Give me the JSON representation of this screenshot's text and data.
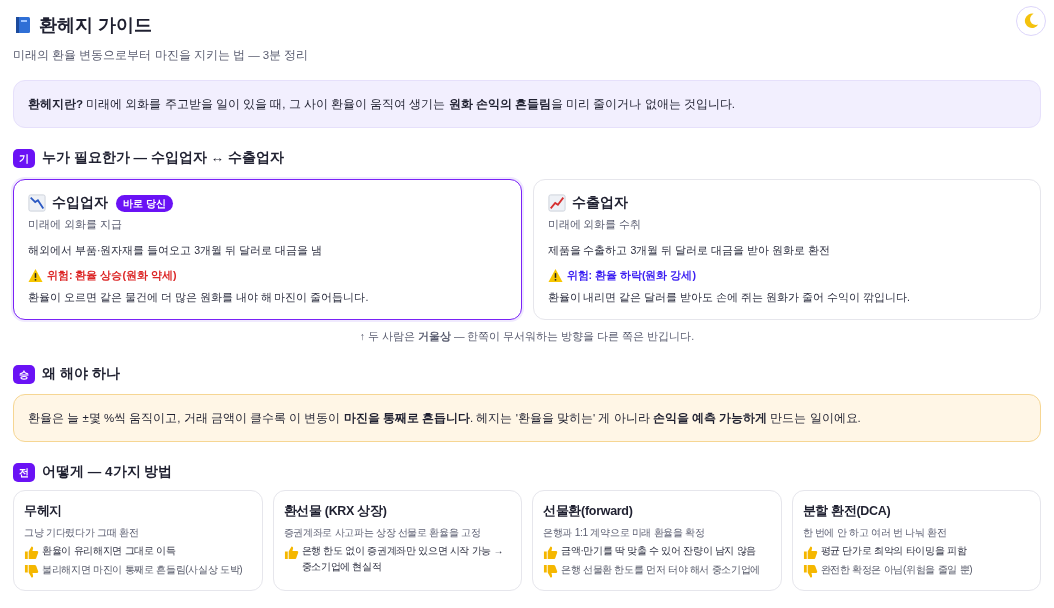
{
  "header": {
    "title": "환헤지 가이드",
    "subtitle": "미래의 환율 변동으로부터 마진을 지키는 법 — 3분 정리"
  },
  "intro": "**환헤지란?** 미래에 외화를 주고받을 일이 있을 때, 그 사이 환율이 움직여 생기는 **원화 손익의 흔들림**을 미리 줄이거나 없애는 것입니다.",
  "sections": [
    {
      "step": "기",
      "title": "누가 필요한가 — 수입업자 ↔ 수출업자",
      "kind": "roles",
      "cards": [
        {
          "title": "수입업자",
          "kind": "down",
          "badge": "바로 당신",
          "highlighted": true,
          "subtitle": "미래에 외화를 지급",
          "body": "해외에서 부품·원자재를 들여오고 3개월 뒤 달러로 대금을 냄",
          "risk": {
            "text": "위험: 환율 상승(원화 약세)",
            "color": "#dc2626"
          },
          "effect": "환율이 오르면 같은 물건에 더 많은 원화를 내야 해 마진이 줄어듭니다."
        },
        {
          "title": "수출업자",
          "kind": "up",
          "highlighted": false,
          "subtitle": "미래에 외화를 수취",
          "body": "제품을 수출하고 3개월 뒤 달러로 대금을 받아 원화로 환전",
          "risk": {
            "text": "위험: 환율 하락(원화 강세)",
            "color": "#3b1ff2"
          },
          "effect": "환율이 내리면 같은 달러를 받아도 손에 쥐는 원화가 줄어 수익이 깎입니다."
        }
      ],
      "note": "↑ 두 사람은 **거울상** — 한쪽이 무서워하는 방향을 다른 쪽은 반깁니다."
    },
    {
      "step": "승",
      "title": "왜 해야 하나",
      "kind": "callout",
      "text": "환율은 늘 ±몇 %씩 움직이고, 거래 금액이 클수록 이 변동이 **마진을 통째로 흔듭니다**. 헤지는 '환율을 맞히는' 게 아니라 **손익을 예측 가능하게** 만드는 일이에요."
    },
    {
      "step": "전",
      "title": "어떻게 — 4가지 방법",
      "kind": "methods",
      "methods": [
        {
          "title": "무헤지",
          "subtitle": "그냥 기다렸다가 그때 환전",
          "points": [
            {
              "kind": "pro",
              "text": "환율이 유리해지면 그대로 이득"
            },
            {
              "kind": "con",
              "text": "불리해지면 마진이 통째로 흔들림(사실상 도박)"
            }
          ]
        },
        {
          "title": "환선물 (KRX 상장)",
          "subtitle": "증권계좌로 사고파는 상장 선물로 환율을 고정",
          "points": [
            {
              "kind": "pro",
              "text": "은행 한도 없이 증권계좌만 있으면 시작 가능 → 중소기업에 현실적"
            }
          ]
        },
        {
          "title": "선물환(forward)",
          "subtitle": "은행과 1:1 계약으로 미래 환율을 확정",
          "points": [
            {
              "kind": "pro",
              "text": "금액·만기를 딱 맞출 수 있어 잔량이 남지 않음"
            },
            {
              "kind": "con",
              "text": "은행 선물환 한도를 먼저 터야 해서 중소기업에"
            }
          ]
        },
        {
          "title": "분할 환전(DCA)",
          "subtitle": "한 번에 안 하고 여러 번 나눠 환전",
          "points": [
            {
              "kind": "pro",
              "text": "평균 단가로 최악의 타이밍을 피함"
            },
            {
              "kind": "con",
              "text": "완전한 확정은 아님(위험을 줄일 뿐)"
            }
          ]
        }
      ]
    }
  ]
}
